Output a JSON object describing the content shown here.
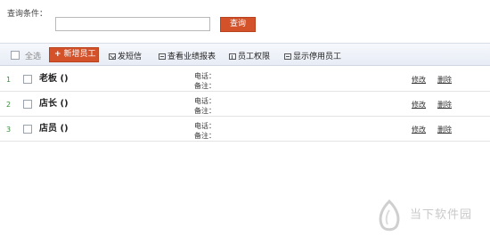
{
  "query": {
    "label": "查询条件：",
    "input_value": "",
    "button_label": "查询"
  },
  "toolbar": {
    "select_all": "全选",
    "add_employee": "新增员工",
    "send_sms": "发短信",
    "view_performance": "查看业绩报表",
    "permissions": "员工权限",
    "show_disabled": "显示停用员工"
  },
  "rows": [
    {
      "num": "1",
      "name": "老板 ()",
      "phone_label": "电话：",
      "note_label": "备注：",
      "edit": "修改",
      "delete": "删除"
    },
    {
      "num": "2",
      "name": "店长 ()",
      "phone_label": "电话：",
      "note_label": "备注：",
      "edit": "修改",
      "delete": "删除"
    },
    {
      "num": "3",
      "name": "店员 ()",
      "phone_label": "电话：",
      "note_label": "备注：",
      "edit": "修改",
      "delete": "删除"
    }
  ],
  "watermark": {
    "text": "当下软件园"
  },
  "colors": {
    "accent": "#d4522a",
    "row_number": "#3a8a3a"
  }
}
